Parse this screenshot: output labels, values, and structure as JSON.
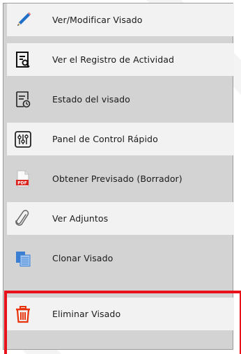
{
  "menu": {
    "items": [
      {
        "label": "Ver/Modificar Visado",
        "icon": "pencil-icon"
      },
      {
        "label": "Ver el Registro de Actividad",
        "icon": "activity-log-icon"
      },
      {
        "label": "Estado del visado",
        "icon": "document-status-icon"
      },
      {
        "label": "Panel de Control Rápido",
        "icon": "control-panel-icon"
      },
      {
        "label": "Obtener Previsado (Borrador)",
        "icon": "pdf-icon"
      },
      {
        "label": "Ver Adjuntos",
        "icon": "paperclip-icon"
      },
      {
        "label": "Clonar Visado",
        "icon": "clone-icon"
      },
      {
        "label": "Eliminar Visado",
        "icon": "trash-icon"
      }
    ],
    "pdf_badge": "PDF"
  },
  "colors": {
    "menu_bg": "#d3d3d3",
    "row_light": "#f2f2f2",
    "highlight": "#e8121a",
    "trash": "#e8320a",
    "pencil": "#1f6fc9"
  }
}
